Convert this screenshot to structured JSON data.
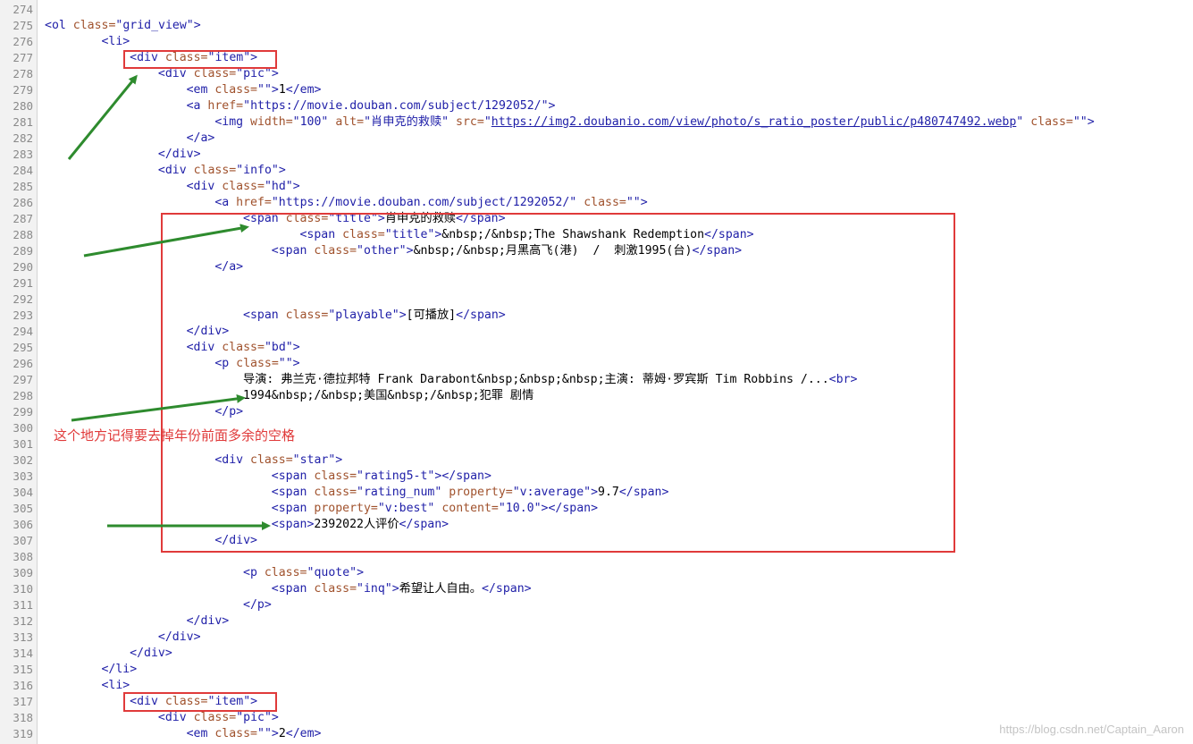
{
  "editor": {
    "lines": [
      {
        "n": "274",
        "indent": 0,
        "tokens": []
      },
      {
        "n": "275",
        "indent": 0,
        "tokens": [
          [
            "t",
            "<ol "
          ],
          [
            "an",
            "class="
          ],
          [
            "av",
            "\"grid_view\""
          ],
          [
            "t",
            ">"
          ]
        ]
      },
      {
        "n": "276",
        "indent": 8,
        "tokens": [
          [
            "t",
            "<li>"
          ]
        ]
      },
      {
        "n": "277",
        "indent": 12,
        "tokens": [
          [
            "t",
            "<div "
          ],
          [
            "an",
            "class="
          ],
          [
            "av",
            "\"item\""
          ],
          [
            "t",
            ">"
          ]
        ]
      },
      {
        "n": "278",
        "indent": 16,
        "tokens": [
          [
            "t",
            "<div "
          ],
          [
            "an",
            "class="
          ],
          [
            "av",
            "\"pic\""
          ],
          [
            "t",
            ">"
          ]
        ]
      },
      {
        "n": "279",
        "indent": 20,
        "tokens": [
          [
            "t",
            "<em "
          ],
          [
            "an",
            "class="
          ],
          [
            "av",
            "\"\""
          ],
          [
            "t",
            ">"
          ],
          [
            "tx",
            "1"
          ],
          [
            "t",
            "</em>"
          ]
        ]
      },
      {
        "n": "280",
        "indent": 20,
        "tokens": [
          [
            "t",
            "<a "
          ],
          [
            "an",
            "href="
          ],
          [
            "av",
            "\"https://movie.douban.com/subject/1292052/\""
          ],
          [
            "t",
            ">"
          ]
        ]
      },
      {
        "n": "281",
        "indent": 24,
        "tokens": [
          [
            "t",
            "<img "
          ],
          [
            "an",
            "width="
          ],
          [
            "av",
            "\"100\""
          ],
          [
            "tx",
            " "
          ],
          [
            "an",
            "alt="
          ],
          [
            "av",
            "\"肖申克的救赎\""
          ],
          [
            "tx",
            " "
          ],
          [
            "an",
            "src="
          ],
          [
            "av",
            "\""
          ],
          [
            "lk",
            "https://img2.doubanio.com/view/photo/s_ratio_poster/public/p480747492.webp"
          ],
          [
            "av",
            "\""
          ],
          [
            "tx",
            " "
          ],
          [
            "an",
            "class="
          ],
          [
            "av",
            "\"\""
          ],
          [
            "t",
            ">"
          ]
        ]
      },
      {
        "n": "282",
        "indent": 20,
        "tokens": [
          [
            "t",
            "</a>"
          ]
        ]
      },
      {
        "n": "283",
        "indent": 16,
        "tokens": [
          [
            "t",
            "</div>"
          ]
        ]
      },
      {
        "n": "284",
        "indent": 16,
        "tokens": [
          [
            "t",
            "<div "
          ],
          [
            "an",
            "class="
          ],
          [
            "av",
            "\"info\""
          ],
          [
            "t",
            ">"
          ]
        ]
      },
      {
        "n": "285",
        "indent": 20,
        "tokens": [
          [
            "t",
            "<div "
          ],
          [
            "an",
            "class="
          ],
          [
            "av",
            "\"hd\""
          ],
          [
            "t",
            ">"
          ]
        ]
      },
      {
        "n": "286",
        "indent": 24,
        "tokens": [
          [
            "t",
            "<a "
          ],
          [
            "an",
            "href="
          ],
          [
            "av",
            "\"https://movie.douban.com/subject/1292052/\""
          ],
          [
            "tx",
            " "
          ],
          [
            "an",
            "class="
          ],
          [
            "av",
            "\"\""
          ],
          [
            "t",
            ">"
          ]
        ]
      },
      {
        "n": "287",
        "indent": 28,
        "tokens": [
          [
            "t",
            "<span "
          ],
          [
            "an",
            "class="
          ],
          [
            "av",
            "\"title\""
          ],
          [
            "t",
            ">"
          ],
          [
            "tx",
            "肖申克的救赎"
          ],
          [
            "t",
            "</span>"
          ]
        ]
      },
      {
        "n": "288",
        "indent": 36,
        "tokens": [
          [
            "t",
            "<span "
          ],
          [
            "an",
            "class="
          ],
          [
            "av",
            "\"title\""
          ],
          [
            "t",
            ">"
          ],
          [
            "tx",
            "&nbsp;/&nbsp;The Shawshank Redemption"
          ],
          [
            "t",
            "</span>"
          ]
        ]
      },
      {
        "n": "289",
        "indent": 32,
        "tokens": [
          [
            "t",
            "<span "
          ],
          [
            "an",
            "class="
          ],
          [
            "av",
            "\"other\""
          ],
          [
            "t",
            ">"
          ],
          [
            "tx",
            "&nbsp;/&nbsp;月黑高飞(港)  /  刺激1995(台)"
          ],
          [
            "t",
            "</span>"
          ]
        ]
      },
      {
        "n": "290",
        "indent": 24,
        "tokens": [
          [
            "t",
            "</a>"
          ]
        ]
      },
      {
        "n": "291",
        "indent": 0,
        "tokens": []
      },
      {
        "n": "292",
        "indent": 0,
        "tokens": []
      },
      {
        "n": "293",
        "indent": 28,
        "tokens": [
          [
            "t",
            "<span "
          ],
          [
            "an",
            "class="
          ],
          [
            "av",
            "\"playable\""
          ],
          [
            "t",
            ">"
          ],
          [
            "tx",
            "[可播放]"
          ],
          [
            "t",
            "</span>"
          ]
        ]
      },
      {
        "n": "294",
        "indent": 20,
        "tokens": [
          [
            "t",
            "</div>"
          ]
        ]
      },
      {
        "n": "295",
        "indent": 20,
        "tokens": [
          [
            "t",
            "<div "
          ],
          [
            "an",
            "class="
          ],
          [
            "av",
            "\"bd\""
          ],
          [
            "t",
            ">"
          ]
        ]
      },
      {
        "n": "296",
        "indent": 24,
        "tokens": [
          [
            "t",
            "<p "
          ],
          [
            "an",
            "class="
          ],
          [
            "av",
            "\"\""
          ],
          [
            "t",
            ">"
          ]
        ]
      },
      {
        "n": "297",
        "indent": 28,
        "tokens": [
          [
            "tx",
            "导演: 弗兰克·德拉邦特 Frank Darabont&nbsp;&nbsp;&nbsp;主演: 蒂姆·罗宾斯 Tim Robbins /..."
          ],
          [
            "t",
            "<br>"
          ]
        ]
      },
      {
        "n": "298",
        "indent": 28,
        "tokens": [
          [
            "tx",
            "1994&nbsp;/&nbsp;美国&nbsp;/&nbsp;犯罪 剧情"
          ]
        ]
      },
      {
        "n": "299",
        "indent": 24,
        "tokens": [
          [
            "t",
            "</p>"
          ]
        ]
      },
      {
        "n": "300",
        "indent": 0,
        "tokens": []
      },
      {
        "n": "301",
        "indent": 0,
        "tokens": []
      },
      {
        "n": "302",
        "indent": 24,
        "tokens": [
          [
            "t",
            "<div "
          ],
          [
            "an",
            "class="
          ],
          [
            "av",
            "\"star\""
          ],
          [
            "t",
            ">"
          ]
        ]
      },
      {
        "n": "303",
        "indent": 32,
        "tokens": [
          [
            "t",
            "<span "
          ],
          [
            "an",
            "class="
          ],
          [
            "av",
            "\"rating5-t\""
          ],
          [
            "t",
            "></span>"
          ]
        ]
      },
      {
        "n": "304",
        "indent": 32,
        "tokens": [
          [
            "t",
            "<span "
          ],
          [
            "an",
            "class="
          ],
          [
            "av",
            "\"rating_num\""
          ],
          [
            "tx",
            " "
          ],
          [
            "an",
            "property="
          ],
          [
            "av",
            "\"v:average\""
          ],
          [
            "t",
            ">"
          ],
          [
            "tx",
            "9.7"
          ],
          [
            "t",
            "</span>"
          ]
        ]
      },
      {
        "n": "305",
        "indent": 32,
        "tokens": [
          [
            "t",
            "<span "
          ],
          [
            "an",
            "property="
          ],
          [
            "av",
            "\"v:best\""
          ],
          [
            "tx",
            " "
          ],
          [
            "an",
            "content="
          ],
          [
            "av",
            "\"10.0\""
          ],
          [
            "t",
            "></span>"
          ]
        ]
      },
      {
        "n": "306",
        "indent": 32,
        "tokens": [
          [
            "t",
            "<span>"
          ],
          [
            "tx",
            "2392022人评价"
          ],
          [
            "t",
            "</span>"
          ]
        ]
      },
      {
        "n": "307",
        "indent": 24,
        "tokens": [
          [
            "t",
            "</div>"
          ]
        ]
      },
      {
        "n": "308",
        "indent": 0,
        "tokens": []
      },
      {
        "n": "309",
        "indent": 28,
        "tokens": [
          [
            "t",
            "<p "
          ],
          [
            "an",
            "class="
          ],
          [
            "av",
            "\"quote\""
          ],
          [
            "t",
            ">"
          ]
        ]
      },
      {
        "n": "310",
        "indent": 32,
        "tokens": [
          [
            "t",
            "<span "
          ],
          [
            "an",
            "class="
          ],
          [
            "av",
            "\"inq\""
          ],
          [
            "t",
            ">"
          ],
          [
            "tx",
            "希望让人自由。"
          ],
          [
            "t",
            "</span>"
          ]
        ]
      },
      {
        "n": "311",
        "indent": 28,
        "tokens": [
          [
            "t",
            "</p>"
          ]
        ]
      },
      {
        "n": "312",
        "indent": 20,
        "tokens": [
          [
            "t",
            "</div>"
          ]
        ]
      },
      {
        "n": "313",
        "indent": 16,
        "tokens": [
          [
            "t",
            "</div>"
          ]
        ]
      },
      {
        "n": "314",
        "indent": 12,
        "tokens": [
          [
            "t",
            "</div>"
          ]
        ]
      },
      {
        "n": "315",
        "indent": 8,
        "tokens": [
          [
            "t",
            "</li>"
          ]
        ]
      },
      {
        "n": "316",
        "indent": 8,
        "tokens": [
          [
            "t",
            "<li>"
          ]
        ]
      },
      {
        "n": "317",
        "indent": 12,
        "tokens": [
          [
            "t",
            "<div "
          ],
          [
            "an",
            "class="
          ],
          [
            "av",
            "\"item\""
          ],
          [
            "t",
            ">"
          ]
        ]
      },
      {
        "n": "318",
        "indent": 16,
        "tokens": [
          [
            "t",
            "<div "
          ],
          [
            "an",
            "class="
          ],
          [
            "av",
            "\"pic\""
          ],
          [
            "t",
            ">"
          ]
        ]
      },
      {
        "n": "319",
        "indent": 20,
        "tokens": [
          [
            "t",
            "<em "
          ],
          [
            "an",
            "class="
          ],
          [
            "av",
            "\"\""
          ],
          [
            "t",
            ">"
          ],
          [
            "tx",
            "2"
          ],
          [
            "t",
            "</em>"
          ]
        ]
      }
    ]
  },
  "annotation": {
    "note": "这个地方记得要去掉年份前面多余的空格",
    "box_color": "#e03a3a",
    "arrow_color": "#2e8b2e"
  },
  "watermark": "https://blog.csdn.net/Captain_Aaron",
  "colors": {
    "tag": "#1f1fa8",
    "attr_name": "#a0522d",
    "attr_value": "#1f1fa8",
    "text": "#000000",
    "line_number": "#8a8a8a"
  }
}
